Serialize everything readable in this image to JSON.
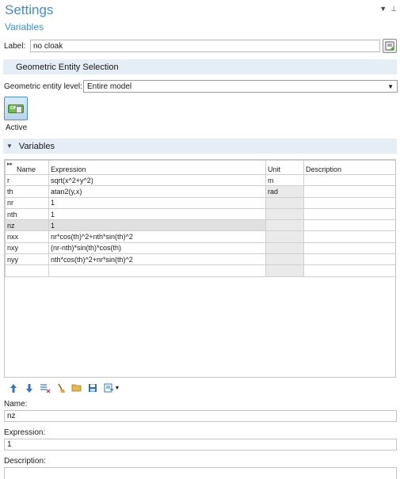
{
  "header": {
    "title": "Settings",
    "subtitle": "Variables"
  },
  "label_field": {
    "label": "Label:",
    "value": "no cloak"
  },
  "geometric_section": {
    "title": "Geometric Entity Selection"
  },
  "geometric_level": {
    "label": "Geometric entity level:",
    "value": "Entire model"
  },
  "active": {
    "label": "Active",
    "toggle_text": "ON"
  },
  "variables_section": {
    "title": "Variables"
  },
  "table": {
    "headers": {
      "name": "Name",
      "expression": "Expression",
      "unit": "Unit",
      "description": "Description"
    },
    "rows": [
      {
        "name": "r",
        "expression": "sqrt(x^2+y^2)",
        "unit": "m",
        "description": ""
      },
      {
        "name": "th",
        "expression": "atan2(y,x)",
        "unit": "rad",
        "description": ""
      },
      {
        "name": "nr",
        "expression": "1",
        "unit": "",
        "description": ""
      },
      {
        "name": "nth",
        "expression": "1",
        "unit": "",
        "description": ""
      },
      {
        "name": "nz",
        "expression": "1",
        "unit": "",
        "description": ""
      },
      {
        "name": "nxx",
        "expression": "nr*cos(th)^2+nth*sin(th)^2",
        "unit": "",
        "description": ""
      },
      {
        "name": "nxy",
        "expression": "(nr-nth)*sin(th)*cos(th)",
        "unit": "",
        "description": ""
      },
      {
        "name": "nyy",
        "expression": "nth*cos(th)^2+nr*sin(th)^2",
        "unit": "",
        "description": ""
      },
      {
        "name": "",
        "expression": "",
        "unit": "",
        "description": ""
      }
    ]
  },
  "detail": {
    "name_label": "Name:",
    "name_value": "nz",
    "expression_label": "Expression:",
    "expression_value": "1",
    "description_label": "Description:",
    "description_value": ""
  },
  "colors": {
    "accent": "#3b8fd0",
    "section_bg": "#e5edf6",
    "unit_cell_bg": "#eaeaea"
  }
}
